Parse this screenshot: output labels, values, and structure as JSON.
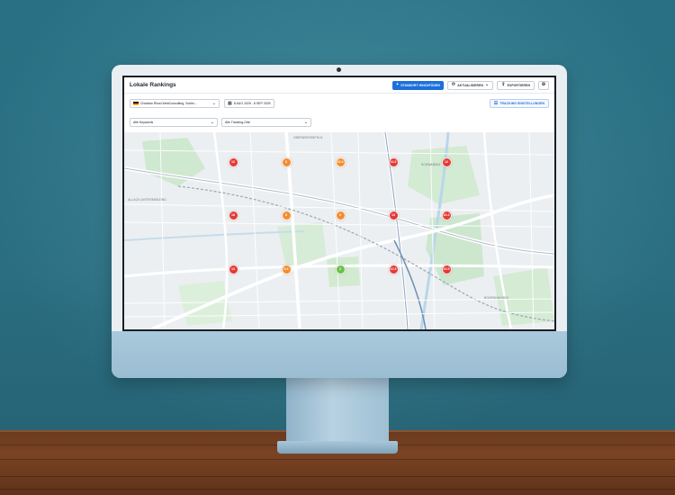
{
  "app": {
    "title": "Lokale Rankings",
    "buttons": {
      "add_location": "STANDORT HINZUFÜGEN",
      "refresh": "AKTUALISIEREN",
      "export": "EXPORTIEREN"
    },
    "business_select": "Christian Rössl WebConsulting, Schlei...",
    "date_range": "8 AUG 2025 - 8 SEP 2025",
    "tracking_settings": "TRACKING EINSTELLUNGEN",
    "keywords_select": "Alle Keywords",
    "locations_select": "Alle Tracking-Orte",
    "icons": {
      "add": "plus-icon",
      "refresh": "refresh-icon",
      "export": "export-icon",
      "settings": "gear-icon",
      "calendar": "calendar-icon",
      "filter": "sliders-icon",
      "chevron": "chevron-down-icon"
    }
  },
  "map": {
    "labels": {
      "oberwiesenfeld": "OBERWIESENFELD",
      "allach": "ALLACH-UNTERMENZING",
      "bogenhausen": "BOGENHAUSEN",
      "schwabing": "SCHWABING"
    },
    "rank_colors": {
      "top": "#6cc04a",
      "mid": "#f48c2f",
      "low": "#e53935"
    },
    "grid_points": [
      {
        "rank": "12",
        "level": "red"
      },
      {
        "rank": "6",
        "level": "orange"
      },
      {
        "rank": "10.4",
        "level": "orange"
      },
      {
        "rank": "11.5",
        "level": "red"
      },
      {
        "rank": "12",
        "level": "red"
      },
      {
        "rank": "18",
        "level": "red"
      },
      {
        "rank": "8",
        "level": "orange"
      },
      {
        "rank": "6",
        "level": "orange"
      },
      {
        "rank": "13",
        "level": "red"
      },
      {
        "rank": "10.4",
        "level": "red"
      },
      {
        "rank": "13",
        "level": "red"
      },
      {
        "rank": "9.3",
        "level": "orange"
      },
      {
        "rank": "2",
        "level": "green"
      },
      {
        "rank": "12.5",
        "level": "red"
      },
      {
        "rank": "13.5",
        "level": "red"
      }
    ]
  }
}
